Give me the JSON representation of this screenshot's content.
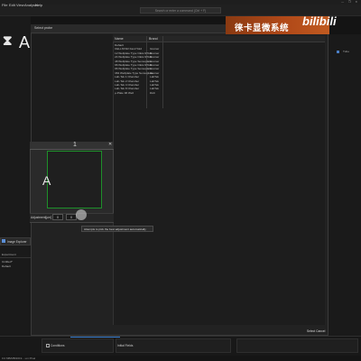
{
  "window": {
    "controls": "—  ❐  ✕"
  },
  "menubar": {
    "items": [
      "File",
      "Edit",
      "View",
      "Analysis",
      "Help"
    ],
    "search_placeholder": "Search or enter a command (Ctrl + F)"
  },
  "app_logo": {
    "mark": "⧗",
    "letter": "A"
  },
  "brand": {
    "text": "徕卡显微系统",
    "logo": "bilibili"
  },
  "dialog": {
    "title": "Select probe",
    "table": {
      "columns": [
        "Name",
        "Brand"
      ],
      "rows": [
        [
          "Default",
          ""
        ],
        [
          "CELLSTAR Fast Hold",
          "Greiner"
        ],
        [
          "12 Wellplate Type CELLSTAR",
          "Greiner"
        ],
        [
          "24 Wellplate Type CELLSTAR",
          "Greiner"
        ],
        [
          "48 Wellplate Type Sensoplate",
          "Greiner"
        ],
        [
          "96 Wellplate Type CELLSTAR",
          "Greiner"
        ],
        [
          "96 Wellplate Type Sensoplate",
          "Greiner"
        ],
        [
          "384 Wellplate Type Sensoplate",
          "Greiner"
        ],
        [
          "Lab-Tek 1 Chamber",
          "LabTek"
        ],
        [
          "Lab-Tek 2 Chamber",
          "LabTek"
        ],
        [
          "Lab-Tek 4 Chamber",
          "LabTek"
        ],
        [
          "Lab-Tek 8 Chamber",
          "LabTek"
        ],
        [
          "µ-Plate 96 Well",
          "ibidi"
        ]
      ]
    },
    "select_cancel": "Select  Cancel"
  },
  "preview": {
    "index": "1",
    "close": "✕",
    "letter": "A",
    "adjustment_label": "Adjustment[µm]",
    "adj_value_1": "0",
    "adj_value_2": "0",
    "tooltip": "Attempts to pick the best adjustment automatically"
  },
  "explorer": {
    "tab_label": "Image Explorer",
    "header": "Experiment",
    "items": [
      "Untitled*",
      "Default"
    ]
  },
  "right_panel": {
    "item": "Tube"
  },
  "bottom": {
    "conditions": "Conditions",
    "initial_fields": "Initial Fields"
  },
  "statusbar": {
    "text": "0.0 MB/MB/2019...  um Pixel"
  },
  "colors": {
    "brand_orange": "#b04818",
    "preview_frame_green": "#1e8f2a",
    "accent_blue": "#3a7fd0"
  }
}
